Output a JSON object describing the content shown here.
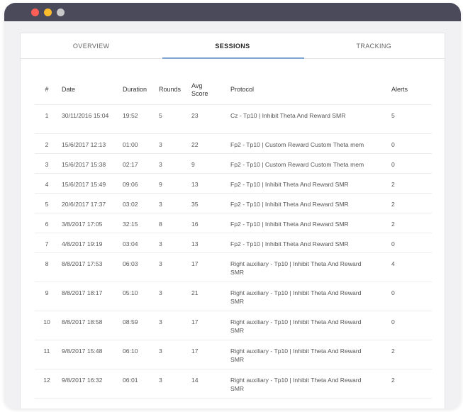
{
  "tabs": [
    {
      "label": "OVERVIEW"
    },
    {
      "label": "SESSIONS"
    },
    {
      "label": "TRACKING"
    }
  ],
  "active_tab": 1,
  "table": {
    "columns": [
      "#",
      "Date",
      "Duration",
      "Rounds",
      "Avg Score",
      "Protocol",
      "Alerts"
    ],
    "rows": [
      {
        "num": "1",
        "date": "30/11/2016 15:04",
        "duration": "19:52",
        "rounds": "5",
        "avg_score": "23",
        "protocol": "Cz - Tp10 | Inhibit Theta And Reward SMR",
        "alerts": "5"
      },
      {
        "num": "2",
        "date": "15/6/2017 12:13",
        "duration": "01:00",
        "rounds": "3",
        "avg_score": "22",
        "protocol": "Fp2 - Tp10 | Custom Reward Custom Theta mem",
        "alerts": "0"
      },
      {
        "num": "3",
        "date": "15/6/2017 15:38",
        "duration": "02:17",
        "rounds": "3",
        "avg_score": "9",
        "protocol": "Fp2 - Tp10 | Custom Reward Custom Theta mem",
        "alerts": "0"
      },
      {
        "num": "4",
        "date": "15/6/2017 15:49",
        "duration": "09:06",
        "rounds": "9",
        "avg_score": "13",
        "protocol": "Fp2 - Tp10 | Inhibit Theta And Reward SMR",
        "alerts": "2"
      },
      {
        "num": "5",
        "date": "20/6/2017 17:37",
        "duration": "03:02",
        "rounds": "3",
        "avg_score": "35",
        "protocol": "Fp2 - Tp10 | Inhibit Theta And Reward SMR",
        "alerts": "2"
      },
      {
        "num": "6",
        "date": "3/8/2017 17:05",
        "duration": "32:15",
        "rounds": "8",
        "avg_score": "16",
        "protocol": "Fp2 - Tp10 | Inhibit Theta And Reward SMR",
        "alerts": "2"
      },
      {
        "num": "7",
        "date": "4/8/2017 19:19",
        "duration": "03:04",
        "rounds": "3",
        "avg_score": "13",
        "protocol": "Fp2 - Tp10 | Inhibit Theta And Reward SMR",
        "alerts": "0"
      },
      {
        "num": "8",
        "date": "8/8/2017 17:53",
        "duration": "06:03",
        "rounds": "3",
        "avg_score": "17",
        "protocol": "Right auxiliary - Tp10 | Inhibit Theta And Reward SMR",
        "alerts": "4"
      },
      {
        "num": "9",
        "date": "8/8/2017 18:17",
        "duration": "05:10",
        "rounds": "3",
        "avg_score": "21",
        "protocol": "Right auxiliary - Tp10 | Inhibit Theta And Reward SMR",
        "alerts": "0"
      },
      {
        "num": "10",
        "date": "8/8/2017 18:58",
        "duration": "08:59",
        "rounds": "3",
        "avg_score": "17",
        "protocol": "Right auxiliary - Tp10 | Inhibit Theta And Reward SMR",
        "alerts": "0"
      },
      {
        "num": "11",
        "date": "9/8/2017 15:48",
        "duration": "06:10",
        "rounds": "3",
        "avg_score": "17",
        "protocol": "Right auxiliary - Tp10 | Inhibit Theta And Reward SMR",
        "alerts": "2"
      },
      {
        "num": "12",
        "date": "9/8/2017 16:32",
        "duration": "06:01",
        "rounds": "3",
        "avg_score": "14",
        "protocol": "Right auxiliary - Tp10 | Inhibit Theta And Reward SMR",
        "alerts": "2"
      }
    ]
  },
  "colors": {
    "titlebar": "#4a4a5a",
    "close": "#ff5f57",
    "minimize": "#ffbd2e",
    "maximize": "#c8c8c8",
    "tab_indicator": "#7fa6cf"
  }
}
